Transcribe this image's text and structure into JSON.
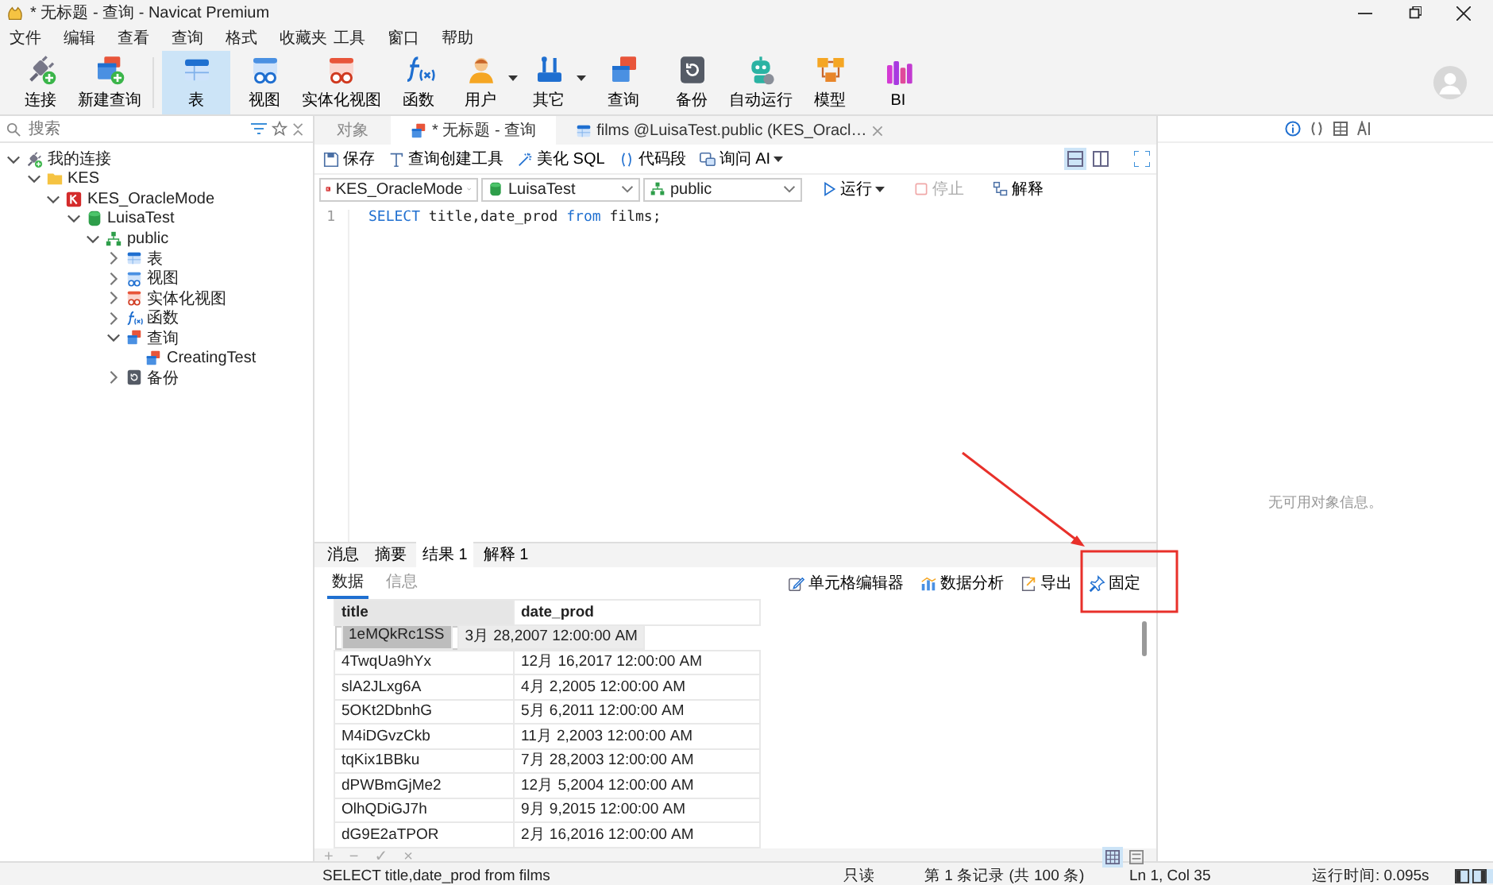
{
  "window": {
    "title": "* 无标题 - 查询 - Navicat Premium"
  },
  "menu": [
    {
      "label": "文件"
    },
    {
      "label": "编辑"
    },
    {
      "label": "查看"
    },
    {
      "label": "查询"
    },
    {
      "label": "格式"
    },
    {
      "label": "收藏夹"
    },
    {
      "label": "工具"
    },
    {
      "label": "窗口"
    },
    {
      "label": "帮助"
    }
  ],
  "toolbar": [
    {
      "label": "连接",
      "kind": "connect",
      "selected": false,
      "dropdown": false
    },
    {
      "label": "新建查询",
      "kind": "newquery",
      "selected": false,
      "dropdown": false
    },
    {
      "label": "表",
      "kind": "table",
      "selected": true,
      "dropdown": false
    },
    {
      "label": "视图",
      "kind": "view",
      "selected": false,
      "dropdown": false
    },
    {
      "label": "实体化视图",
      "kind": "matview",
      "selected": false,
      "dropdown": false
    },
    {
      "label": "函数",
      "kind": "function",
      "selected": false,
      "dropdown": false
    },
    {
      "label": "用户",
      "kind": "user",
      "selected": false,
      "dropdown": true
    },
    {
      "label": "其它",
      "kind": "tools",
      "selected": false,
      "dropdown": true
    },
    {
      "label": "查询",
      "kind": "query",
      "selected": false,
      "dropdown": false
    },
    {
      "label": "备份",
      "kind": "backup",
      "selected": false,
      "dropdown": false
    },
    {
      "label": "自动运行",
      "kind": "robot",
      "selected": false,
      "dropdown": false
    },
    {
      "label": "模型",
      "kind": "model",
      "selected": false,
      "dropdown": false
    },
    {
      "label": "BI",
      "kind": "bi",
      "selected": false,
      "dropdown": false
    }
  ],
  "sidebar": {
    "search": {
      "placeholder": "搜索"
    },
    "tree": [
      {
        "label": "我的连接",
        "kind": "connect",
        "expanded": true,
        "children": [
          {
            "label": "KES",
            "kind": "folder",
            "expanded": true,
            "children": [
              {
                "label": "KES_OracleMode",
                "kind": "server",
                "expanded": true,
                "children": [
                  {
                    "label": "LuisaTest",
                    "kind": "database",
                    "expanded": true,
                    "children": [
                      {
                        "label": "public",
                        "kind": "schema",
                        "expanded": true,
                        "children": [
                          {
                            "label": "表",
                            "kind": "table",
                            "expanded": false
                          },
                          {
                            "label": "视图",
                            "kind": "view",
                            "expanded": false
                          },
                          {
                            "label": "实体化视图",
                            "kind": "matview",
                            "expanded": false
                          },
                          {
                            "label": "函数",
                            "kind": "function",
                            "expanded": false
                          },
                          {
                            "label": "查询",
                            "kind": "query",
                            "expanded": true,
                            "children": [
                              {
                                "label": "CreatingTest",
                                "kind": "query"
                              }
                            ]
                          },
                          {
                            "label": "备份",
                            "kind": "backup",
                            "expanded": false
                          }
                        ]
                      }
                    ]
                  }
                ]
              }
            ]
          }
        ]
      }
    ]
  },
  "editor_tabs": [
    {
      "label": "对象",
      "kind": "object",
      "selected": false,
      "closable": false
    },
    {
      "label": "* 无标题 - 查询",
      "kind": "query",
      "selected": true,
      "closable": false
    },
    {
      "label": "films @LuisaTest.public (KES_Oracl…",
      "kind": "table",
      "selected": false,
      "closable": true
    }
  ],
  "editor_toolbar": [
    {
      "label": "保存",
      "kind": "save",
      "dropdown": false
    },
    {
      "label": "查询创建工具",
      "kind": "builder",
      "dropdown": false
    },
    {
      "label": "美化 SQL",
      "kind": "beautify",
      "dropdown": false
    },
    {
      "label": "代码段",
      "kind": "snippet",
      "dropdown": false
    },
    {
      "label": "询问 AI",
      "kind": "ai",
      "dropdown": true
    }
  ],
  "view_modes": [
    {
      "kind": "stacked",
      "selected": true
    },
    {
      "kind": "side",
      "selected": false
    }
  ],
  "selectors": [
    {
      "value": "KES_OracleMode",
      "kind": "server"
    },
    {
      "value": "LuisaTest",
      "kind": "database"
    },
    {
      "value": "public",
      "kind": "schema"
    }
  ],
  "run_actions": [
    {
      "label": "运行",
      "kind": "run",
      "disabled": false,
      "dropdown": true
    },
    {
      "label": "停止",
      "kind": "stop",
      "disabled": true,
      "dropdown": false
    },
    {
      "label": "解释",
      "kind": "explain",
      "disabled": false,
      "dropdown": false
    }
  ],
  "editor": {
    "lines": [
      {
        "number": "1",
        "tokens": [
          {
            "text": "SELECT",
            "kind": "keyword"
          },
          {
            "text": " title,date_prod ",
            "kind": "plain"
          },
          {
            "text": "from",
            "kind": "keyword"
          },
          {
            "text": " films;",
            "kind": "plain"
          }
        ]
      }
    ]
  },
  "results": {
    "tabs": [
      {
        "label": "消息",
        "selected": false
      },
      {
        "label": "摘要",
        "selected": false
      },
      {
        "label": "结果 1",
        "selected": true
      },
      {
        "label": "解释 1",
        "selected": false
      }
    ],
    "subtabs": [
      {
        "label": "数据",
        "selected": true
      },
      {
        "label": "信息",
        "selected": false
      }
    ],
    "actions": [
      {
        "label": "单元格编辑器",
        "kind": "edit"
      },
      {
        "label": "数据分析",
        "kind": "chart"
      },
      {
        "label": "导出",
        "kind": "export"
      },
      {
        "label": "固定",
        "kind": "pin"
      }
    ],
    "table": {
      "columns": [
        "title",
        "date_prod"
      ],
      "rows": [
        {
          "cells": [
            "1eMQkRc1SS",
            "3月 28,2007 12:00:00 AM"
          ],
          "selected": true
        },
        {
          "cells": [
            "4TwqUa9hYx",
            "12月 16,2017 12:00:00 AM"
          ],
          "selected": false
        },
        {
          "cells": [
            "slA2JLxg6A",
            "4月 2,2005 12:00:00 AM"
          ],
          "selected": false
        },
        {
          "cells": [
            "5OKt2DbnhG",
            "5月 6,2011 12:00:00 AM"
          ],
          "selected": false
        },
        {
          "cells": [
            "M4iDGvzCkb",
            "11月 2,2003 12:00:00 AM"
          ],
          "selected": false
        },
        {
          "cells": [
            "tqKix1BBku",
            "7月 28,2003 12:00:00 AM"
          ],
          "selected": false
        },
        {
          "cells": [
            "dPWBmGjMe2",
            "12月 5,2004 12:00:00 AM"
          ],
          "selected": false
        },
        {
          "cells": [
            "OlhQDiGJ7h",
            "9月 9,2015 12:00:00 AM"
          ],
          "selected": false
        },
        {
          "cells": [
            "dG9E2aTPOR",
            "2月 16,2016 12:00:00 AM"
          ],
          "selected": false
        }
      ]
    },
    "row_actions": [
      "+",
      "−",
      "✓",
      "×"
    ],
    "grid_modes": [
      {
        "kind": "grid",
        "selected": true
      },
      {
        "kind": "form",
        "selected": false
      }
    ]
  },
  "info_panel": {
    "tabs": [
      {
        "kind": "info",
        "selected": true
      },
      {
        "kind": "ddl",
        "selected": false
      },
      {
        "kind": "columns",
        "selected": false
      },
      {
        "kind": "ai",
        "selected": false
      }
    ],
    "message": "无可用对象信息。"
  },
  "status_bar": {
    "sql": "SELECT title,date_prod from films",
    "mode": "只读",
    "record": "第 1 条记录 (共 100 条)",
    "cursor": "Ln 1, Col 35",
    "elapsed": "运行时间: 0.095s"
  }
}
